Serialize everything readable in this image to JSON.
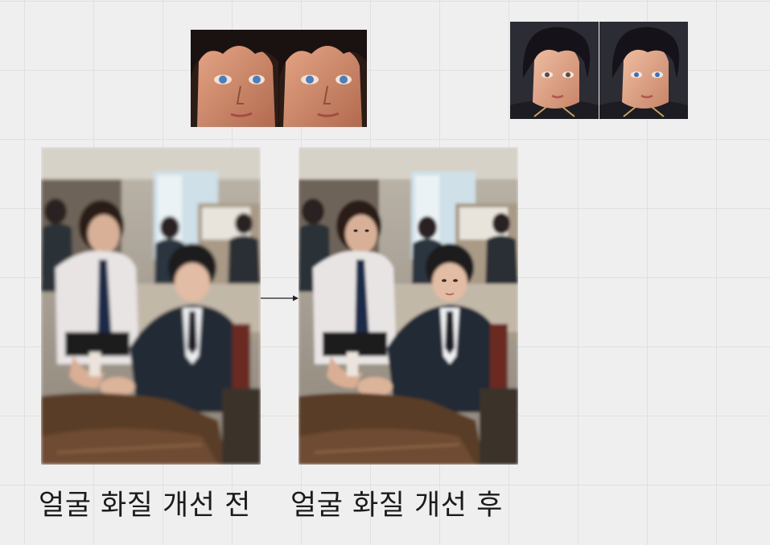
{
  "canvas": {
    "background": "#efefef",
    "grid_color": "#e0e0e0"
  },
  "images": {
    "face_pair_a": {
      "description_icon": "face-crop-comparison"
    },
    "face_pair_b": {
      "description_icon": "face-crop-comparison"
    },
    "photo_before": {
      "description_icon": "office-photo-blurry"
    },
    "photo_after": {
      "description_icon": "office-photo-enhanced"
    }
  },
  "connector": {
    "icon": "arrow-right-icon",
    "color": "#222222"
  },
  "captions": {
    "before": "얼굴 화질 개선 전",
    "after": "얼굴 화질 개선 후"
  }
}
